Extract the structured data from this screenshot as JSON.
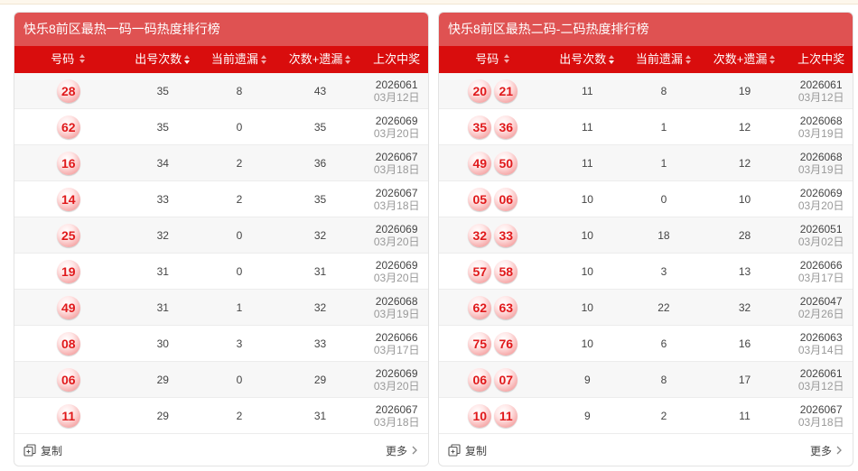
{
  "left": {
    "title": "快乐8前区最热一码一码热度排行榜",
    "headers": {
      "num": "号码",
      "count": "出号次数",
      "omit": "当前遗漏",
      "sum": "次数+遗漏",
      "last": "上次中奖"
    },
    "rows": [
      {
        "nums": [
          "28"
        ],
        "count": "35",
        "omit": "8",
        "sum": "43",
        "issue": "2026061",
        "date": "03月12日"
      },
      {
        "nums": [
          "62"
        ],
        "count": "35",
        "omit": "0",
        "sum": "35",
        "issue": "2026069",
        "date": "03月20日"
      },
      {
        "nums": [
          "16"
        ],
        "count": "34",
        "omit": "2",
        "sum": "36",
        "issue": "2026067",
        "date": "03月18日"
      },
      {
        "nums": [
          "14"
        ],
        "count": "33",
        "omit": "2",
        "sum": "35",
        "issue": "2026067",
        "date": "03月18日"
      },
      {
        "nums": [
          "25"
        ],
        "count": "32",
        "omit": "0",
        "sum": "32",
        "issue": "2026069",
        "date": "03月20日"
      },
      {
        "nums": [
          "19"
        ],
        "count": "31",
        "omit": "0",
        "sum": "31",
        "issue": "2026069",
        "date": "03月20日"
      },
      {
        "nums": [
          "49"
        ],
        "count": "31",
        "omit": "1",
        "sum": "32",
        "issue": "2026068",
        "date": "03月19日"
      },
      {
        "nums": [
          "08"
        ],
        "count": "30",
        "omit": "3",
        "sum": "33",
        "issue": "2026066",
        "date": "03月17日"
      },
      {
        "nums": [
          "06"
        ],
        "count": "29",
        "omit": "0",
        "sum": "29",
        "issue": "2026069",
        "date": "03月20日"
      },
      {
        "nums": [
          "11"
        ],
        "count": "29",
        "omit": "2",
        "sum": "31",
        "issue": "2026067",
        "date": "03月18日"
      }
    ],
    "copy_label": "复制",
    "more_label": "更多"
  },
  "right": {
    "title": "快乐8前区最热二码-二码热度排行榜",
    "headers": {
      "num": "号码",
      "count": "出号次数",
      "omit": "当前遗漏",
      "sum": "次数+遗漏",
      "last": "上次中奖"
    },
    "rows": [
      {
        "nums": [
          "20",
          "21"
        ],
        "count": "11",
        "omit": "8",
        "sum": "19",
        "issue": "2026061",
        "date": "03月12日"
      },
      {
        "nums": [
          "35",
          "36"
        ],
        "count": "11",
        "omit": "1",
        "sum": "12",
        "issue": "2026068",
        "date": "03月19日"
      },
      {
        "nums": [
          "49",
          "50"
        ],
        "count": "11",
        "omit": "1",
        "sum": "12",
        "issue": "2026068",
        "date": "03月19日"
      },
      {
        "nums": [
          "05",
          "06"
        ],
        "count": "10",
        "omit": "0",
        "sum": "10",
        "issue": "2026069",
        "date": "03月20日"
      },
      {
        "nums": [
          "32",
          "33"
        ],
        "count": "10",
        "omit": "18",
        "sum": "28",
        "issue": "2026051",
        "date": "03月02日"
      },
      {
        "nums": [
          "57",
          "58"
        ],
        "count": "10",
        "omit": "3",
        "sum": "13",
        "issue": "2026066",
        "date": "03月17日"
      },
      {
        "nums": [
          "62",
          "63"
        ],
        "count": "10",
        "omit": "22",
        "sum": "32",
        "issue": "2026047",
        "date": "02月26日"
      },
      {
        "nums": [
          "75",
          "76"
        ],
        "count": "10",
        "omit": "6",
        "sum": "16",
        "issue": "2026063",
        "date": "03月14日"
      },
      {
        "nums": [
          "06",
          "07"
        ],
        "count": "9",
        "omit": "8",
        "sum": "17",
        "issue": "2026061",
        "date": "03月12日"
      },
      {
        "nums": [
          "10",
          "11"
        ],
        "count": "9",
        "omit": "2",
        "sum": "11",
        "issue": "2026067",
        "date": "03月18日"
      }
    ],
    "copy_label": "复制",
    "more_label": "更多"
  },
  "icons": {
    "sort": "sort-icon",
    "copy": "copy-icon",
    "more": "chevron-right-icon"
  },
  "colors": {
    "title_bg": "#df5252",
    "header_bg": "#d90d0d",
    "ball_text": "#e0191b"
  }
}
